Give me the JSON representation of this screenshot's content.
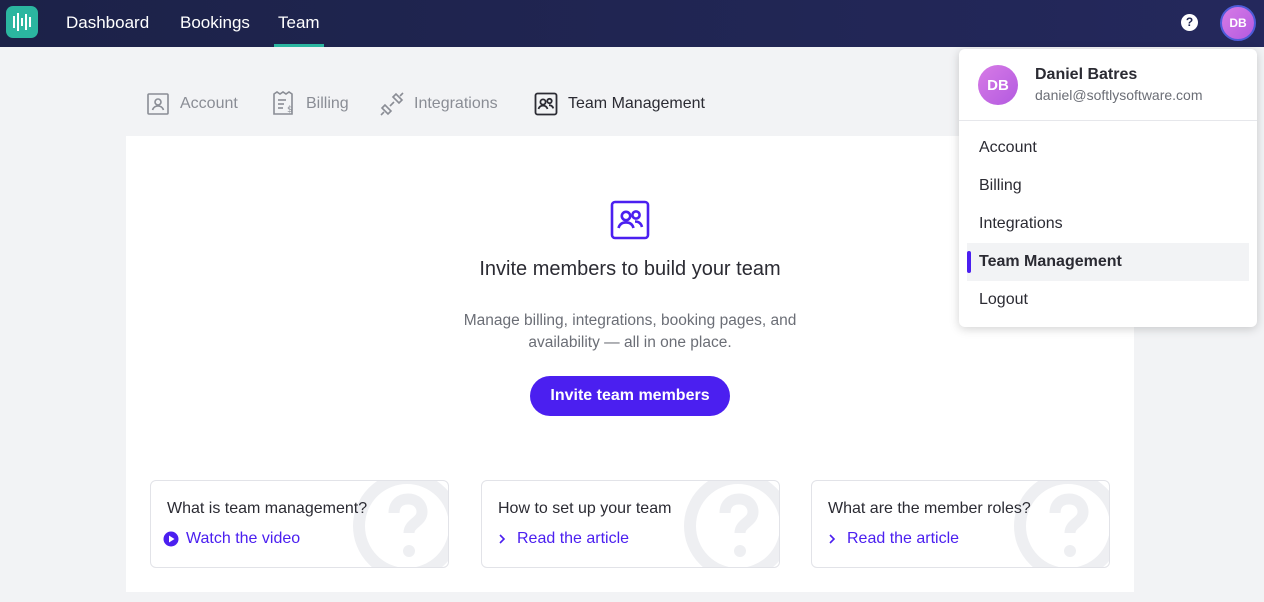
{
  "topnav": {
    "items": [
      {
        "label": "Dashboard"
      },
      {
        "label": "Bookings"
      },
      {
        "label": "Team"
      }
    ],
    "help_label": "?",
    "avatar_initials": "DB"
  },
  "tabs": [
    {
      "label": "Account",
      "icon": "account-icon"
    },
    {
      "label": "Billing",
      "icon": "billing-icon"
    },
    {
      "label": "Integrations",
      "icon": "integrations-icon"
    },
    {
      "label": "Team Management",
      "icon": "team-icon"
    }
  ],
  "main": {
    "title": "Invite members to build your team",
    "description": "Manage billing, integrations, booking pages, and availability — all in one place.",
    "invite_button": "Invite team members",
    "help_cards": [
      {
        "question": "What is team management?",
        "link": "Watch the video",
        "link_icon": "play-icon"
      },
      {
        "question": "How to set up your team",
        "link": "Read the article",
        "link_icon": "chevron-right-icon"
      },
      {
        "question": "What are the member roles?",
        "link": "Read the article",
        "link_icon": "chevron-right-icon"
      }
    ]
  },
  "dropdown": {
    "initials": "DB",
    "name": "Daniel Batres",
    "email": "daniel@softlysoftware.com",
    "items": [
      {
        "label": "Account"
      },
      {
        "label": "Billing"
      },
      {
        "label": "Integrations"
      },
      {
        "label": "Team Management"
      },
      {
        "label": "Logout"
      }
    ]
  },
  "colors": {
    "nav_bg": "#1f2450",
    "accent": "#4b1ff0",
    "teal": "#2bb6a0"
  }
}
